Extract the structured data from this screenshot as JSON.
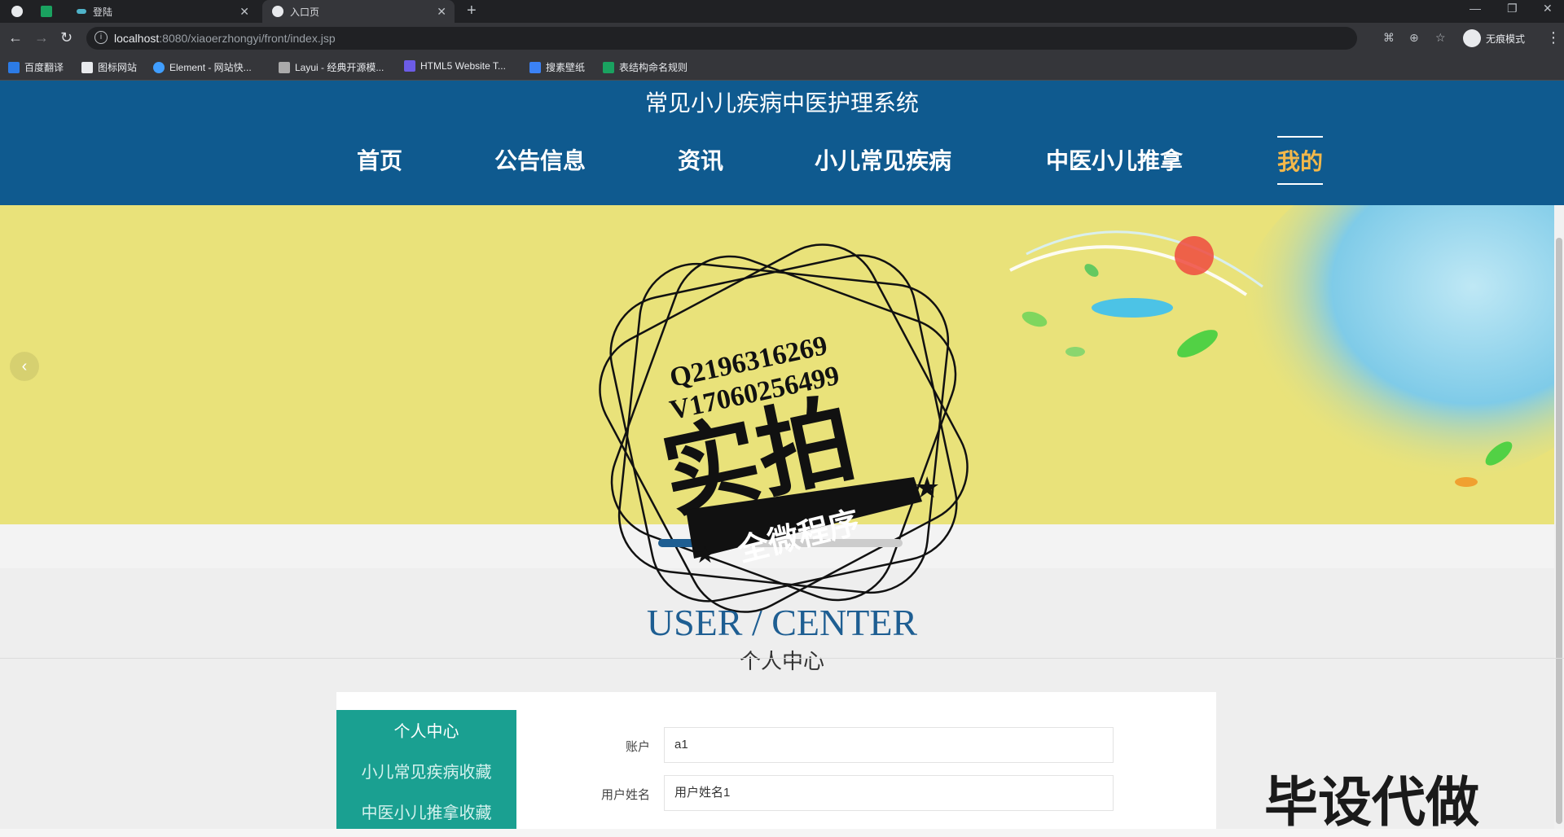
{
  "browser": {
    "tabs": [
      {
        "title": ""
      },
      {
        "title": "登陆"
      },
      {
        "title": "入口页"
      }
    ],
    "url_host": "localhost",
    "url_path": ":8080/xiaoerzhongyi/front/index.jsp",
    "incognito_label": "无痕模式",
    "bookmarks": [
      {
        "label": "百度翻译"
      },
      {
        "label": "图标网站"
      },
      {
        "label": "Element - 网站快..."
      },
      {
        "label": "Layui - 经典开源模..."
      },
      {
        "label": "HTML5 Website T..."
      },
      {
        "label": "搜素壁纸"
      },
      {
        "label": "表结构命名规则"
      }
    ]
  },
  "site": {
    "title": "常见小儿疾病中医护理系统",
    "nav": [
      {
        "label": "首页"
      },
      {
        "label": "公告信息"
      },
      {
        "label": "资讯"
      },
      {
        "label": "小儿常见疾病"
      },
      {
        "label": "中医小儿推拿"
      },
      {
        "label": "我的"
      }
    ],
    "active_nav": "我的"
  },
  "watermark": {
    "line1": "Q2196316269",
    "line2": "V17060256499",
    "big": "实拍",
    "ribbon": "全微程序"
  },
  "user_center": {
    "title_en": "USER / CENTER",
    "title_cn": "个人中心"
  },
  "sidebar": {
    "items": [
      {
        "label": "个人中心"
      },
      {
        "label": "小儿常见疾病收藏"
      },
      {
        "label": "中医小儿推拿收藏"
      }
    ]
  },
  "form": {
    "account_label": "账户",
    "account_value": "a1",
    "name_label": "用户姓名",
    "name_value": "用户姓名1"
  },
  "ad_text": "毕设代做",
  "colors": {
    "header": "#0f5a8f",
    "banner": "#e9e27a",
    "accent": "#1aa091",
    "active_nav": "#f3b84a"
  }
}
